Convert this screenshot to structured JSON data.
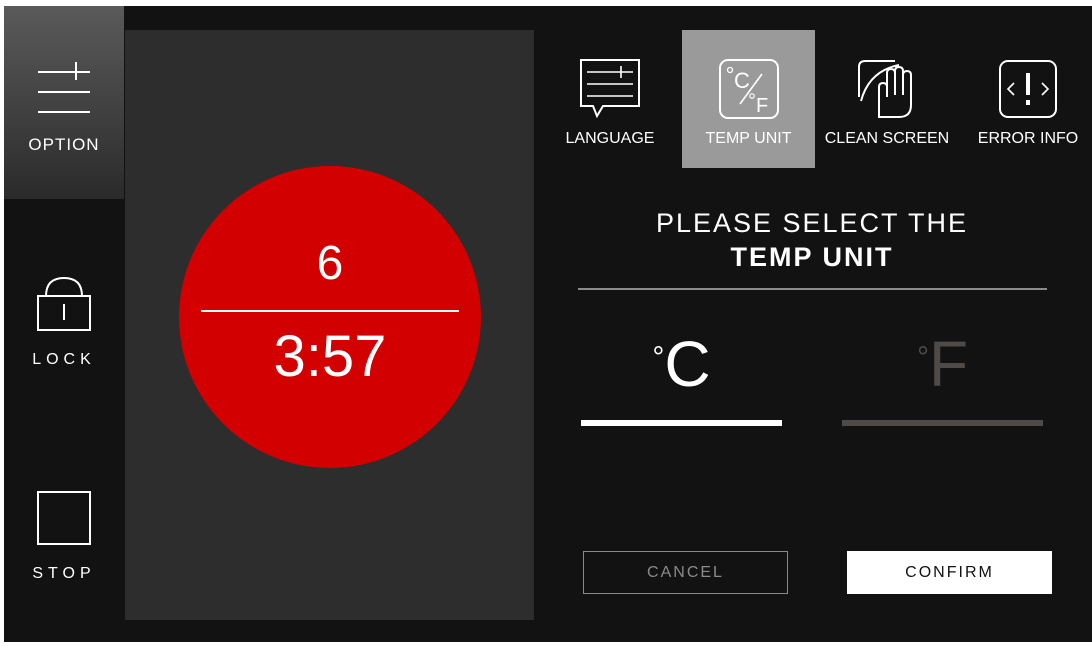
{
  "sidebar": {
    "option": {
      "label": "OPTION",
      "icon": "sliders-icon"
    },
    "lock": {
      "label": "LOCK",
      "icon": "padlock-icon"
    },
    "stop": {
      "label": "STOP",
      "icon": "stop-square-icon"
    }
  },
  "timer": {
    "level": "6",
    "time": "3:57",
    "circle_color": "#d20000"
  },
  "tabs": [
    {
      "label": "LANGUAGE",
      "icon": "language-speech-icon",
      "active": false
    },
    {
      "label": "TEMP UNIT",
      "icon": "temp-unit-icon",
      "active": true
    },
    {
      "label": "CLEAN SCREEN",
      "icon": "hand-wipe-icon",
      "active": false
    },
    {
      "label": "ERROR INFO",
      "icon": "error-exclamation-icon",
      "active": false
    }
  ],
  "prompt": {
    "line1": "PLEASE SELECT THE",
    "line2": "TEMP UNIT"
  },
  "units": {
    "celsius": {
      "degree": "°",
      "letter": "C",
      "selected": true
    },
    "fahrenheit": {
      "degree": "°",
      "letter": "F",
      "selected": false
    }
  },
  "buttons": {
    "cancel": "CANCEL",
    "confirm": "CONFIRM"
  },
  "colors": {
    "background": "#121212",
    "panel": "#2d2d2d",
    "active_tab": "#9a9a9a",
    "accent_red": "#d20000"
  }
}
